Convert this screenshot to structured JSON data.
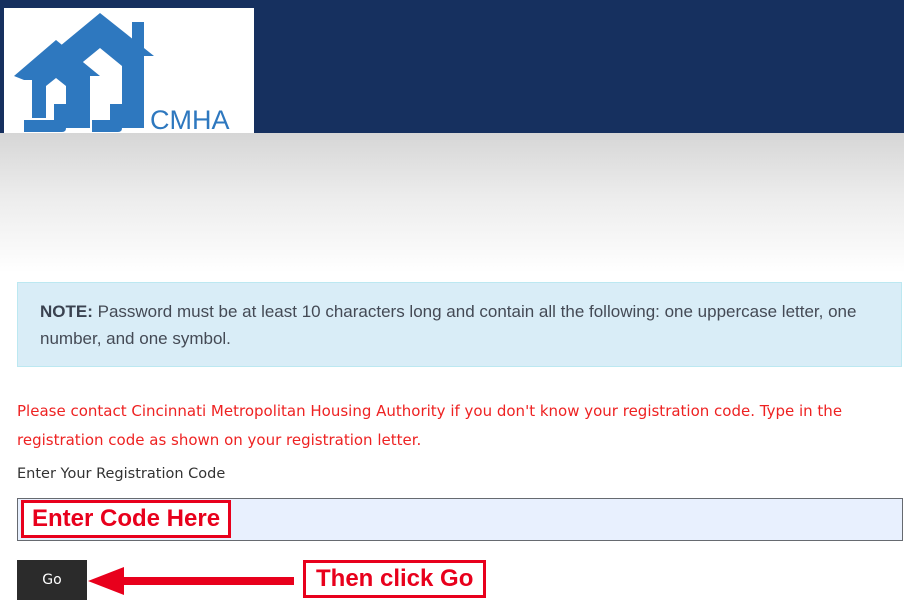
{
  "header": {
    "logo_text": "CMHA",
    "brand_color": "#16305f",
    "logo_color": "#2e78bf"
  },
  "note": {
    "label": "NOTE:",
    "text": " Password must be at least 10 characters long and contain all the following: one uppercase letter, one number, and one symbol."
  },
  "instructions": "Please contact Cincinnati Metropolitan Housing Authority if you don't know your registration code. Type in the registration code as shown on your registration letter.",
  "form": {
    "label": "Enter Your Registration Code",
    "input_value": "",
    "go_label": "Go"
  },
  "annotations": {
    "code_callout": "Enter Code Here",
    "go_callout": "Then click Go",
    "annotation_color": "#e8001c",
    "arrow_icon": "left-arrow-icon"
  }
}
